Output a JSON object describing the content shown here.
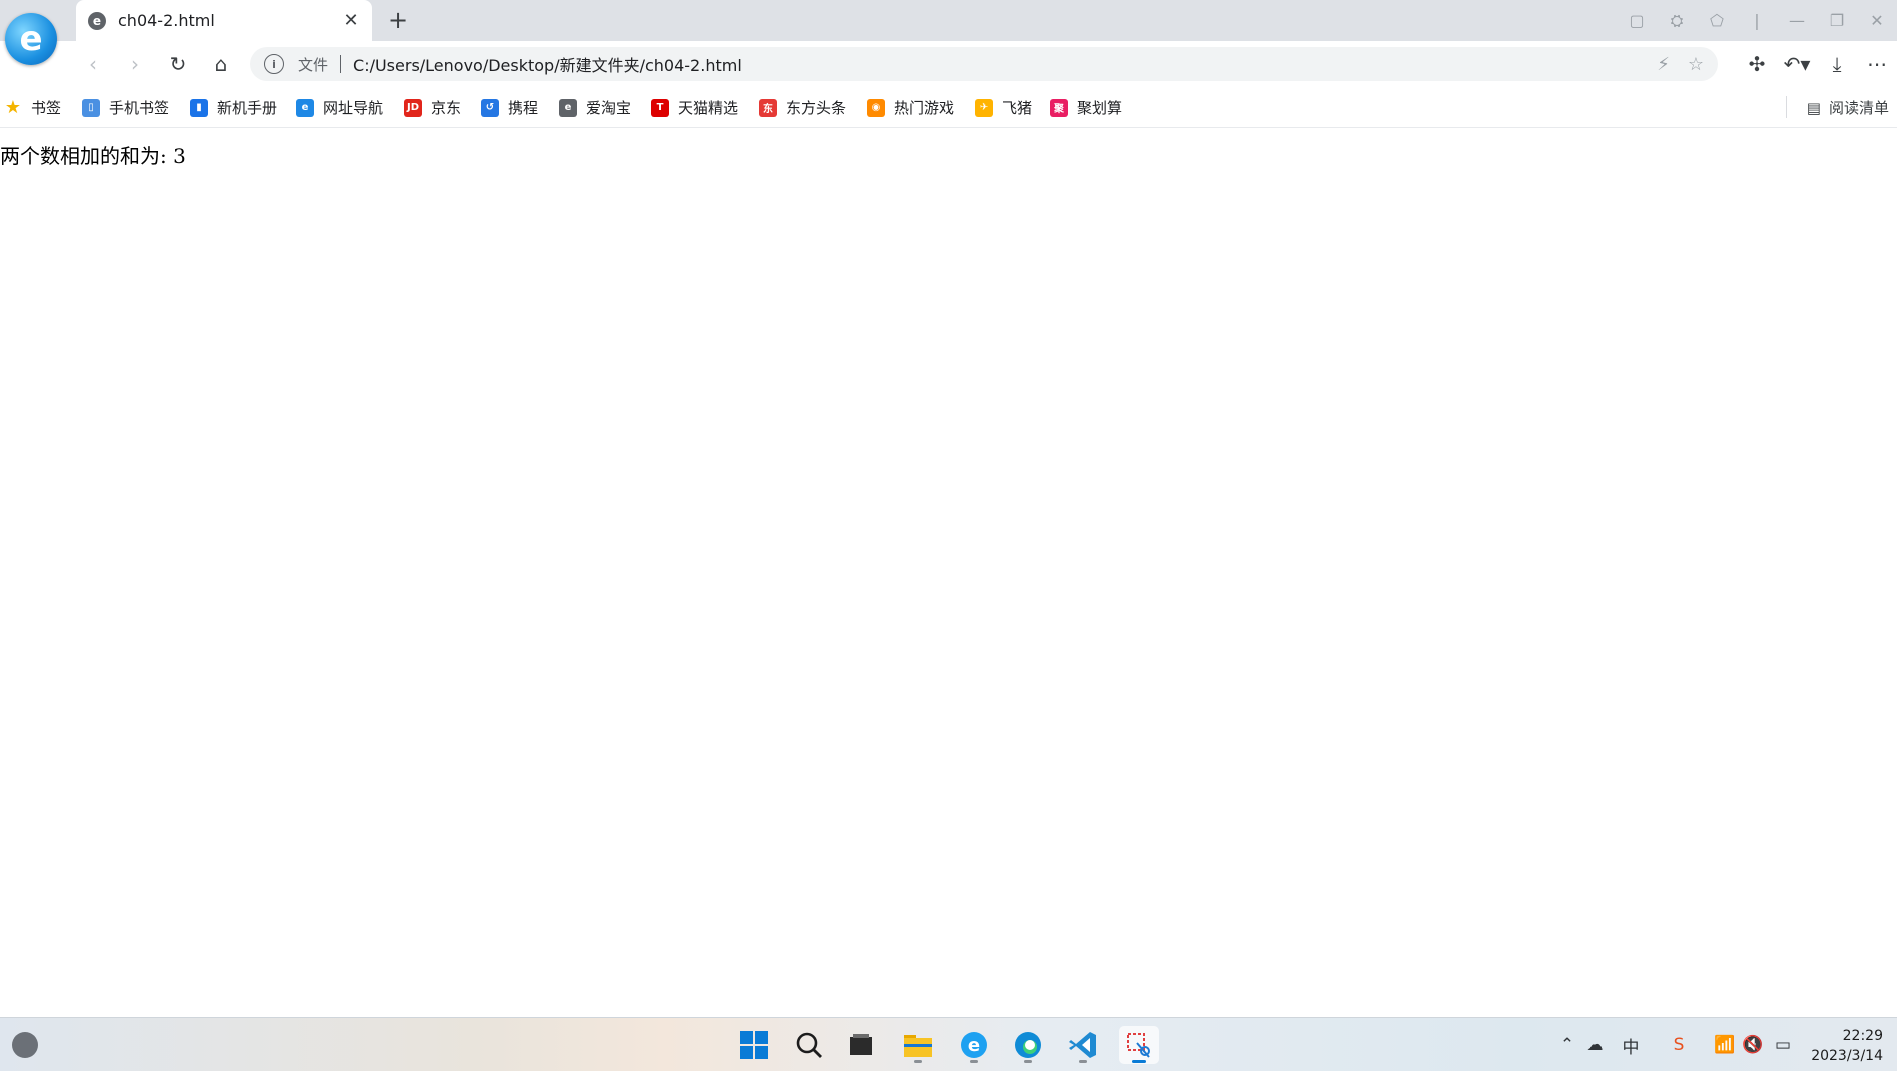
{
  "tab": {
    "title": "ch04-2.html"
  },
  "address": {
    "scheme_label": "文件",
    "url": "C:/Users/Lenovo/Desktop/新建文件夹/ch04-2.html"
  },
  "bookmarks": [
    {
      "label": "书签",
      "icon": "star-icon",
      "color": "#f4b400"
    },
    {
      "label": "手机书签",
      "icon": "phone-bookmark-icon",
      "color": "#4a90e2"
    },
    {
      "label": "新机手册",
      "icon": "manual-icon",
      "color": "#1a73e8"
    },
    {
      "label": "网址导航",
      "icon": "navigation-icon",
      "color": "#1e88e5"
    },
    {
      "label": "京东",
      "icon": "jd-icon",
      "color": "#e1251b"
    },
    {
      "label": "携程",
      "icon": "ctrip-icon",
      "color": "#2577e3"
    },
    {
      "label": "爱淘宝",
      "icon": "taobao-icon",
      "color": "#5f6368"
    },
    {
      "label": "天猫精选",
      "icon": "tmall-icon",
      "color": "#d00"
    },
    {
      "label": "东方头条",
      "icon": "dftt-icon",
      "color": "#e53935"
    },
    {
      "label": "热门游戏",
      "icon": "game-icon",
      "color": "#ff8a00"
    },
    {
      "label": "飞猪",
      "icon": "fliggy-icon",
      "color": "#ffb300"
    },
    {
      "label": "聚划算",
      "icon": "juhuasuan-icon",
      "color": "#e91e63"
    }
  ],
  "reading_list": {
    "label": "阅读清单"
  },
  "page": {
    "result_text": "两个数相加的和为: 3"
  },
  "taskbar": {
    "time": "22:29",
    "date": "2023/3/14"
  }
}
